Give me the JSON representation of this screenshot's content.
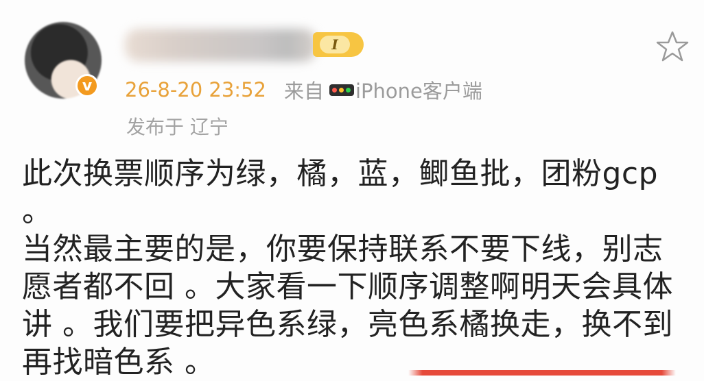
{
  "post": {
    "timestamp": "26-8-20 23:52",
    "from_label": "来自",
    "device_icon": "app-dots-icon",
    "device": "iPhone客户端",
    "location": "发布于 辽宁",
    "level_badge": "I",
    "body": "此次换票顺序为绿，橘，蓝，鲫鱼批，团粉gcp 。\n当然最主要的是，你要保持联系不要下线，别志\n愿者都不回 。大家看一下顺序调整啊明天会具体\n讲 。我们要把异色系绿，亮色系橘换走，换不到\n再找暗色系 。"
  },
  "icons": {
    "favorite": "star-outline-icon",
    "verified": "verified-v-icon"
  },
  "colors": {
    "timestamp": "#e8a23a",
    "verified_badge": "#f39a1f",
    "level_badge": "#f7c542",
    "accent_bar": "#e64a3b"
  }
}
